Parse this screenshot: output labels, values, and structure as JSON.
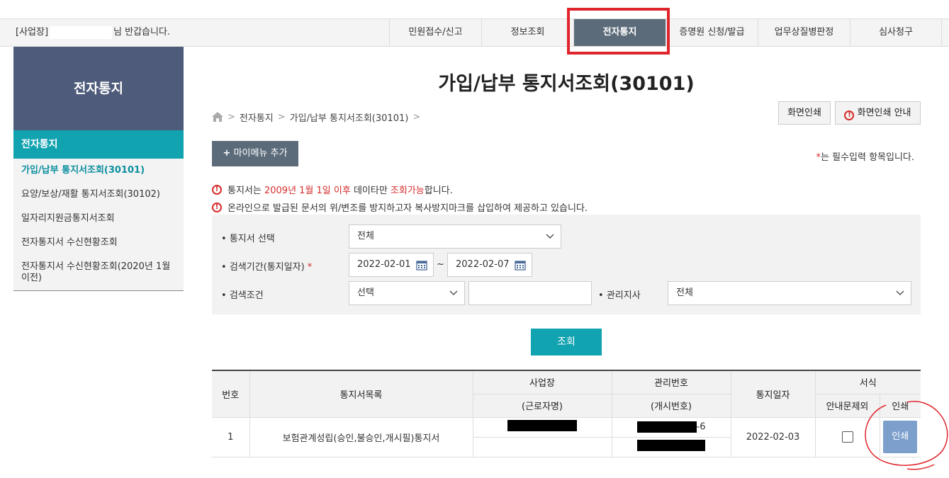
{
  "header": {
    "welcome_prefix": "[사업장]",
    "welcome_suffix": "님 반갑습니다.",
    "nav": [
      "민원접수/신고",
      "정보조회",
      "전자통지",
      "증명원 신청/발급",
      "업무상질병판정",
      "심사청구"
    ],
    "active_nav": "전자통지"
  },
  "sidebar": {
    "heading": "전자통지",
    "category": "전자통지",
    "items": [
      "가입/납부 통지서조회(30101)",
      "요양/보상/재활 통지서조회(30102)",
      "일자리지원금통지서조회",
      "전자통지서 수신현황조회",
      "전자통지서 수신현황조회(2020년 1월 이전)"
    ]
  },
  "main": {
    "title": "가입/납부 통지서조회(30101)",
    "breadcrumb": [
      "전자통지",
      "가입/납부 통지서조회(30101)"
    ],
    "print_screen": "화면인쇄",
    "print_guide": "화면인쇄 안내",
    "mymenu": "마이메뉴 추가",
    "required_note": "는 필수입력 항목입니다.",
    "notice1": {
      "a": "통지서는 ",
      "b": "2009년 1월 1일 이후",
      "c": " 데이타만 ",
      "d": "조회가능",
      "e": "합니다."
    },
    "notice2": "온라인으로 발급된 문서의 위/변조를 방지하고자 복사방지마크를 삽입하여 제공하고 있습니다."
  },
  "search": {
    "type_label": "통지서 선택",
    "type_value": "전체",
    "period_label": "검색기간(통지일자)",
    "date_from": "2022-02-01",
    "date_to": "2022-02-07",
    "tilde": "~",
    "cond_label": "검색조건",
    "cond_value": "선택",
    "cond_text": "",
    "branch_label": "관리지사",
    "branch_value": "전체",
    "button": "조회"
  },
  "table": {
    "headers": {
      "no": "번호",
      "doc": "통지서목록",
      "company": "사업장",
      "company_sub": "(근로자명)",
      "mgmt": "관리번호",
      "mgmt_sub": "(개시번호)",
      "date": "통지일자",
      "form": "서식",
      "exclude": "안내문제외",
      "print": "인쇄"
    },
    "rows": [
      {
        "no": "1",
        "doc": "보험관계성립(승인,불승인,개시필)통지서",
        "mgmt_tail": "-6",
        "date": "2022-02-03",
        "print": "인쇄"
      }
    ]
  },
  "colors": {
    "nav_active": "#5c6b7a",
    "teal": "#11a3b0",
    "sidebar_head": "#4e5b7a",
    "print_btn": "#7d9fcc",
    "highlight": "#e0242b"
  }
}
